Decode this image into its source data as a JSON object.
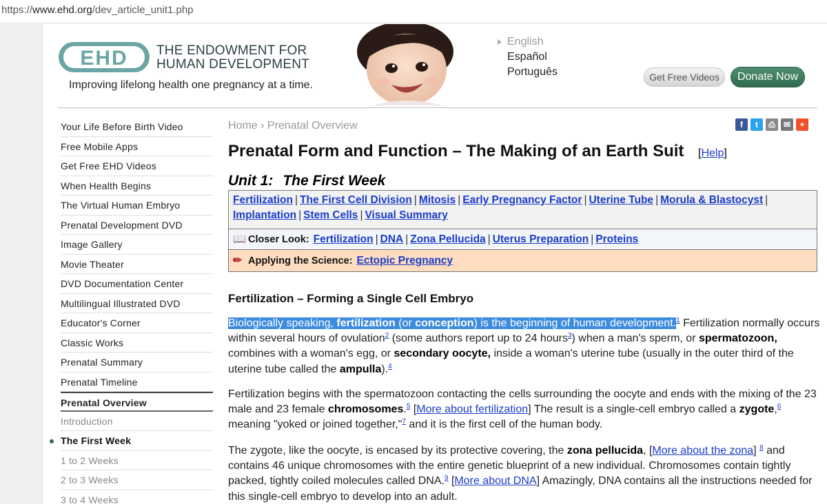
{
  "browser": {
    "url_prefix": "https://",
    "url_domain": "www.ehd.org",
    "url_path": "/dev_article_unit1.php"
  },
  "header": {
    "logo_text": "EHD",
    "org_line1": "THE ENDOWMENT FOR",
    "org_line2": "HUMAN DEVELOPMENT",
    "tagline": "Improving lifelong health one pregnancy at a time.",
    "languages": [
      "English",
      "Español",
      "Português"
    ],
    "btn_videos": "Get Free Videos",
    "btn_donate": "Donate Now",
    "colors": {
      "logo": "#6aa6a5",
      "donate": "#3a7a5a"
    }
  },
  "sidebar": {
    "items": [
      "Your Life Before Birth Video",
      "Free Mobile Apps",
      "Get Free EHD Videos",
      "When Health Begins",
      "The Virtual Human Embryo",
      "Prenatal Development DVD",
      "Image Gallery",
      "Movie Theater",
      "DVD Documentation Center",
      "Multilingual Illustrated DVD",
      "Educator's Corner",
      "Classic Works",
      "Prenatal Summary",
      "Prenatal Timeline",
      "Prenatal Overview",
      "Introduction",
      "The First Week",
      "1 to 2 Weeks",
      "2 to 3 Weeks",
      "3 to 4 Weeks"
    ]
  },
  "main": {
    "breadcrumb": "Home › Prenatal Overview",
    "social_icons": [
      "facebook-icon",
      "twitter-icon",
      "print-icon",
      "email-icon",
      "share-icon"
    ],
    "title": "Prenatal Form and Function – The Making of an Earth Suit",
    "help": "Help",
    "unit_label": "Unit 1:",
    "unit_name": "The First Week",
    "nav_row1": [
      "Fertilization",
      "The First Cell Division",
      "Mitosis",
      "Early Pregnancy Factor",
      "Uterine Tube",
      "Morula & Blastocyst",
      "Implantation",
      "Stem Cells",
      "Visual Summary"
    ],
    "closer_look_label": "Closer Look:",
    "closer_look": [
      "Fertilization",
      "DNA",
      "Zona Pellucida",
      "Uterus Preparation",
      "Proteins"
    ],
    "applying_label": "Applying the Science:",
    "applying": [
      "Ectopic Pregnancy"
    ],
    "section_heading": "Fertilization – Forming a Single Cell Embryo",
    "p1": {
      "t1": "Biologically speaking, ",
      "b1": "fertilization",
      "t2": " (or ",
      "b2": "conception",
      "t3": ") is the beginning of human development.",
      "r1": "1",
      "t4": " Fertilization normally occurs within several hours of ovulation",
      "r2": "2",
      "t5": " (some authors report up to 24 hours",
      "r3": "3",
      "t6": ") when a man's sperm, or ",
      "b3": "spermatozoon,",
      "t7": " combines with a woman's egg, or ",
      "b4": "secondary oocyte,",
      "t8": " inside a woman's uterine tube (usually in the outer third of the uterine tube called the ",
      "b5": "ampulla",
      "t9": ").",
      "r4": "4"
    },
    "p2": {
      "t1": "Fertilization begins with the spermatozoon contacting the cells surrounding the oocyte and ends with the mixing of the 23 male and 23 female ",
      "b1": "chromosomes",
      "t2": ".",
      "r1": "5",
      "t3": " [",
      "l1": "More about fertilization",
      "t4": "] The result is a single-cell embryo called a ",
      "b2": "zygote",
      "t5": ",",
      "r2": "6",
      "t6": " meaning \"yoked or joined together,\"",
      "r3": "7",
      "t7": " and it is the first cell of the human body."
    },
    "p3": {
      "t1": "The zygote, like the oocyte, is encased by its protective covering, the ",
      "b1": "zona pellucida",
      "t2": ", [",
      "l1": "More about the zona",
      "t3": "] ",
      "r1": "8",
      "t4": " and contains 46 unique chromosomes with the entire genetic blueprint of a new individual. Chromosomes contain tightly packed, tightly coiled molecules called DNA.",
      "r2": "9",
      "t5": " [",
      "l2": "More about DNA",
      "t6": "] Amazingly, DNA contains all the instructions needed for this single-cell embryo to develop into an adult."
    }
  }
}
